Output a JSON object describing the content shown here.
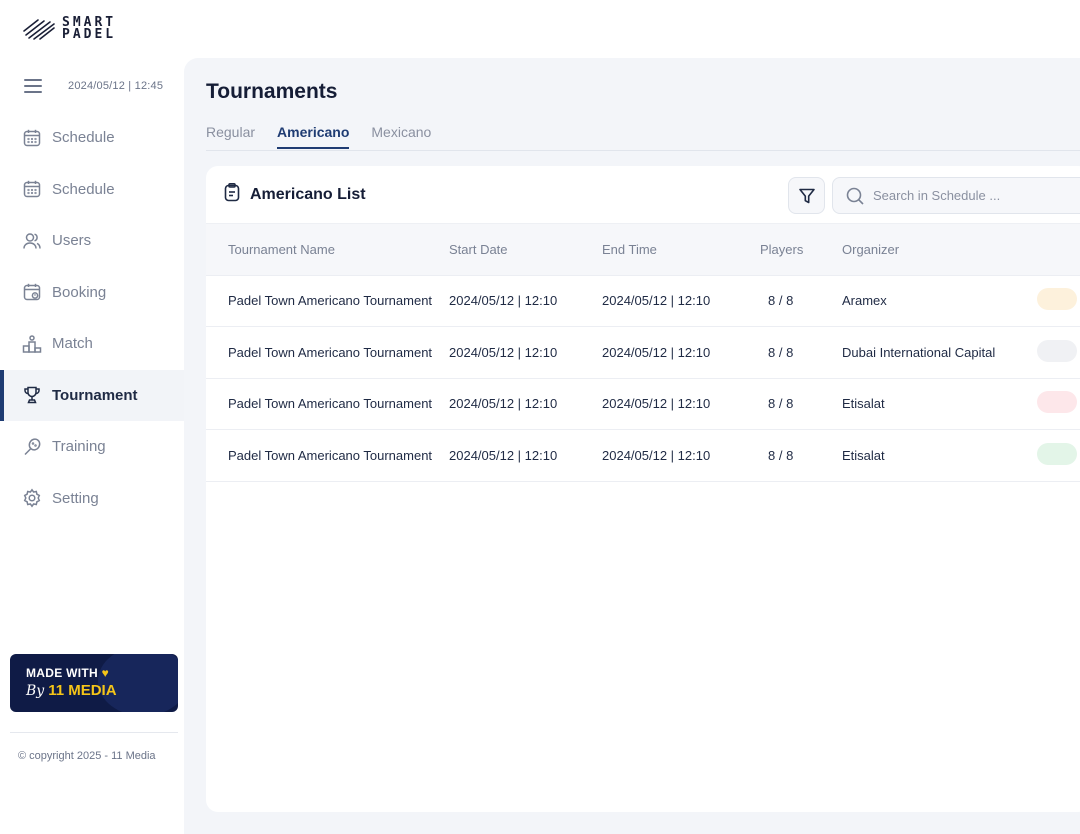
{
  "brand": {
    "line1": "SMART",
    "line2": "PADEL"
  },
  "header": {
    "datetime": "2024/05/12 | 12:45"
  },
  "sidebar": {
    "items": [
      {
        "label": "Schedule",
        "icon": "calendar-icon",
        "active": false
      },
      {
        "label": "Schedule",
        "icon": "calendar-icon",
        "active": false
      },
      {
        "label": "Users",
        "icon": "users-icon",
        "active": false
      },
      {
        "label": "Booking",
        "icon": "booking-icon",
        "active": false
      },
      {
        "label": "Match",
        "icon": "match-icon",
        "active": false
      },
      {
        "label": "Tournament",
        "icon": "trophy-icon",
        "active": true
      },
      {
        "label": "Training",
        "icon": "racket-icon",
        "active": false
      },
      {
        "label": "Setting",
        "icon": "gear-icon",
        "active": false
      }
    ],
    "badge": {
      "line1": "MADE WITH",
      "by": "By",
      "brand": "11 MEDIA"
    },
    "copyright": "© copyright 2025 - 11 Media"
  },
  "page": {
    "title": "Tournaments",
    "tabs": [
      {
        "label": "Regular",
        "active": false
      },
      {
        "label": "Americano",
        "active": true
      },
      {
        "label": "Mexicano",
        "active": false
      }
    ]
  },
  "list": {
    "title": "Americano List",
    "search_placeholder": "Search in Schedule ...",
    "columns": [
      "Tournament Name",
      "Start Date",
      "End Time",
      "Players",
      "Organizer"
    ],
    "rows": [
      {
        "name": "Padel Town Americano Tournament",
        "start": "2024/05/12 | 12:10",
        "end": "2024/05/12 | 12:10",
        "players": "8 / 8",
        "organizer": "Aramex",
        "status_color": "#fdf1dc"
      },
      {
        "name": "Padel Town Americano Tournament",
        "start": "2024/05/12 | 12:10",
        "end": "2024/05/12 | 12:10",
        "players": "8 / 8",
        "organizer": "Dubai International Capital",
        "status_color": "#f0f1f4"
      },
      {
        "name": "Padel Town Americano Tournament",
        "start": "2024/05/12 | 12:10",
        "end": "2024/05/12 | 12:10",
        "players": "8 / 8",
        "organizer": "Etisalat",
        "status_color": "#fde7ea"
      },
      {
        "name": "Padel Town Americano Tournament",
        "start": "2024/05/12 | 12:10",
        "end": "2024/05/12 | 12:10",
        "players": "8 / 8",
        "organizer": "Etisalat",
        "status_color": "#e3f5e8"
      }
    ]
  }
}
